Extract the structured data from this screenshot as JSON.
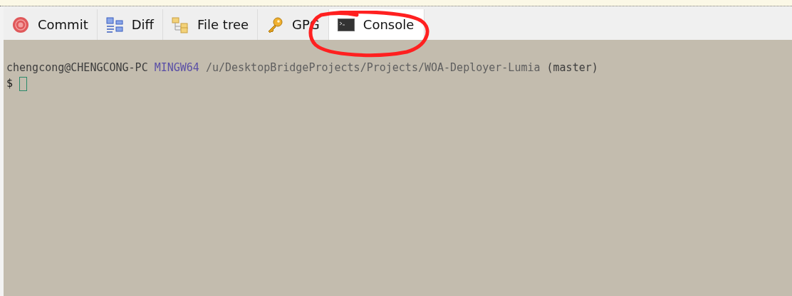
{
  "tabs": [
    {
      "label": "Commit",
      "kind": "commit",
      "selected": false
    },
    {
      "label": "Diff",
      "kind": "diff",
      "selected": false
    },
    {
      "label": "File tree",
      "kind": "tree",
      "selected": false
    },
    {
      "label": "GPG",
      "kind": "key",
      "selected": false
    },
    {
      "label": "Console",
      "kind": "console",
      "selected": true
    }
  ],
  "console": {
    "user_host": "chengcong@CHENGCONG-PC",
    "system": "MINGW64",
    "path": "/u/DesktopBridgeProjects/Projects/WOA-Deployer-Lumia",
    "branch": "(master)",
    "prompt": "$"
  },
  "annotation": {
    "kind": "circle"
  }
}
